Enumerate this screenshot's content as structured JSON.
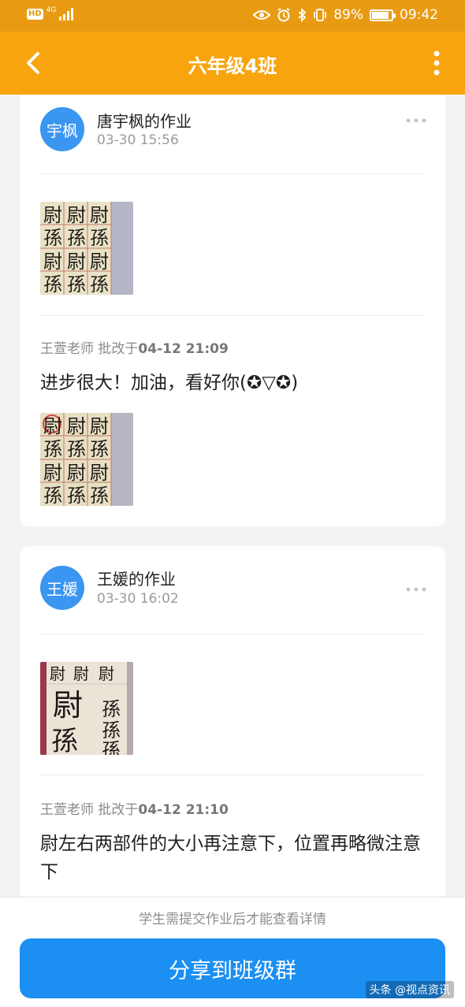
{
  "status_bar": {
    "hd": "HD",
    "network": "4G",
    "battery_percent": "89%",
    "battery_level": 0.89,
    "time": "09:42"
  },
  "nav": {
    "title": "六年级4班"
  },
  "posts": [
    {
      "avatar_text": "宇枫",
      "title": "唐宇枫的作业",
      "time": "03-30 15:56",
      "review": {
        "teacher_label": "王萱老师 批改于",
        "datetime": "04-12 21:09",
        "comment": "进步很大！加油，看好你(✪▽✪)"
      }
    },
    {
      "avatar_text": "王媛",
      "title": "王媛的作业",
      "time": "03-30 16:02",
      "review": {
        "teacher_label": "王萱老师 批改于",
        "datetime": "04-12 21:10",
        "comment": "尉左右两部件的大小再注意下，位置再略微注意下"
      }
    }
  ],
  "photos": {
    "post1_upload": [
      "尉",
      "孫",
      "尉",
      "孫"
    ],
    "post1_graded": [
      "尉",
      "孫",
      "尉",
      "孫"
    ],
    "post2_upload": [
      "尉",
      "孫"
    ]
  },
  "bottom": {
    "hint": "学生需提交作业后才能查看详情",
    "share_label": "分享到班级群",
    "watermark": "头条 @视点资讯"
  },
  "colors": {
    "statusbar": "#e89b12",
    "navbar": "#f7a40e",
    "avatar": "#3a96f0",
    "share_button": "#1b8ff2"
  },
  "icons": {
    "back": "chevron-left-icon",
    "more": "vertical-dots-icon",
    "card_more": "horizontal-dots-icon"
  }
}
